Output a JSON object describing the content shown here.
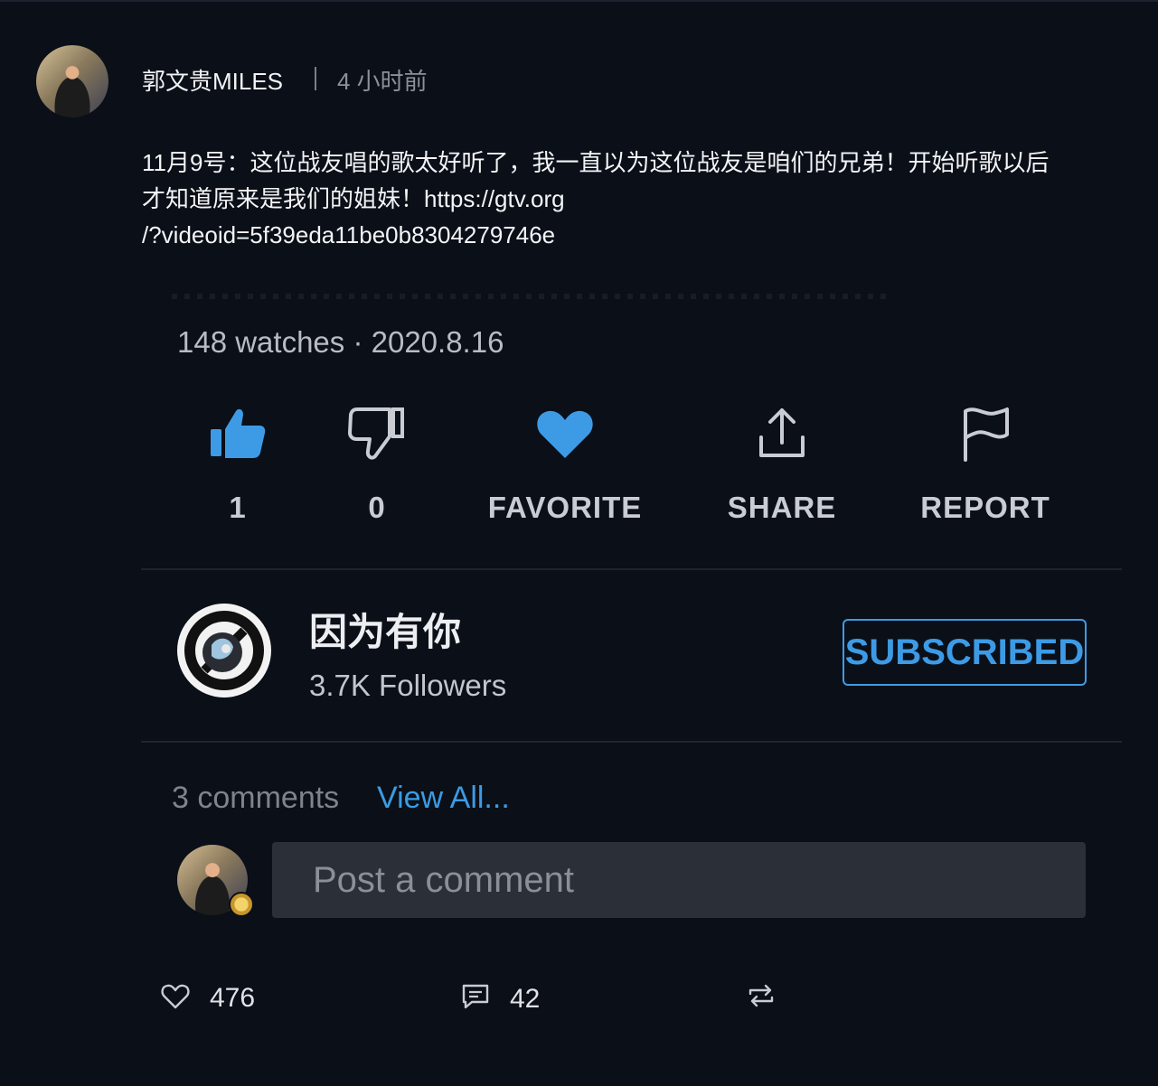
{
  "post": {
    "author": "郭文贵MILES",
    "separator": "|",
    "time": "4 小时前",
    "text_lines": [
      "11月9号：这位战友唱的歌太好听了，我一直以为这位战友是咱们的兄弟！开始听歌以后",
      "才知道原来是我们的姐妹！https://gtv.org",
      "/?videoid=5f39eda11be0b8304279746e"
    ]
  },
  "video": {
    "watches_line": "148 watches · 2020.8.16",
    "actions": [
      {
        "icon": "thumbs-up-icon",
        "label": "1"
      },
      {
        "icon": "thumbs-down-icon",
        "label": "0"
      },
      {
        "icon": "heart-icon",
        "label": "FAVORITE"
      },
      {
        "icon": "share-upload-icon",
        "label": "SHARE"
      },
      {
        "icon": "flag-icon",
        "label": "REPORT"
      }
    ]
  },
  "channel": {
    "name": "因为有你",
    "followers": "3.7K Followers",
    "button": "SUBSCRIBED"
  },
  "comments": {
    "count": "3 comments",
    "view_all": "View All...",
    "placeholder": "Post a comment"
  },
  "stats": {
    "likes": "476",
    "comments": "42"
  },
  "colors": {
    "background": "#0a0f18",
    "accent": "#3d9be6",
    "input_bg": "#2a2f38"
  }
}
